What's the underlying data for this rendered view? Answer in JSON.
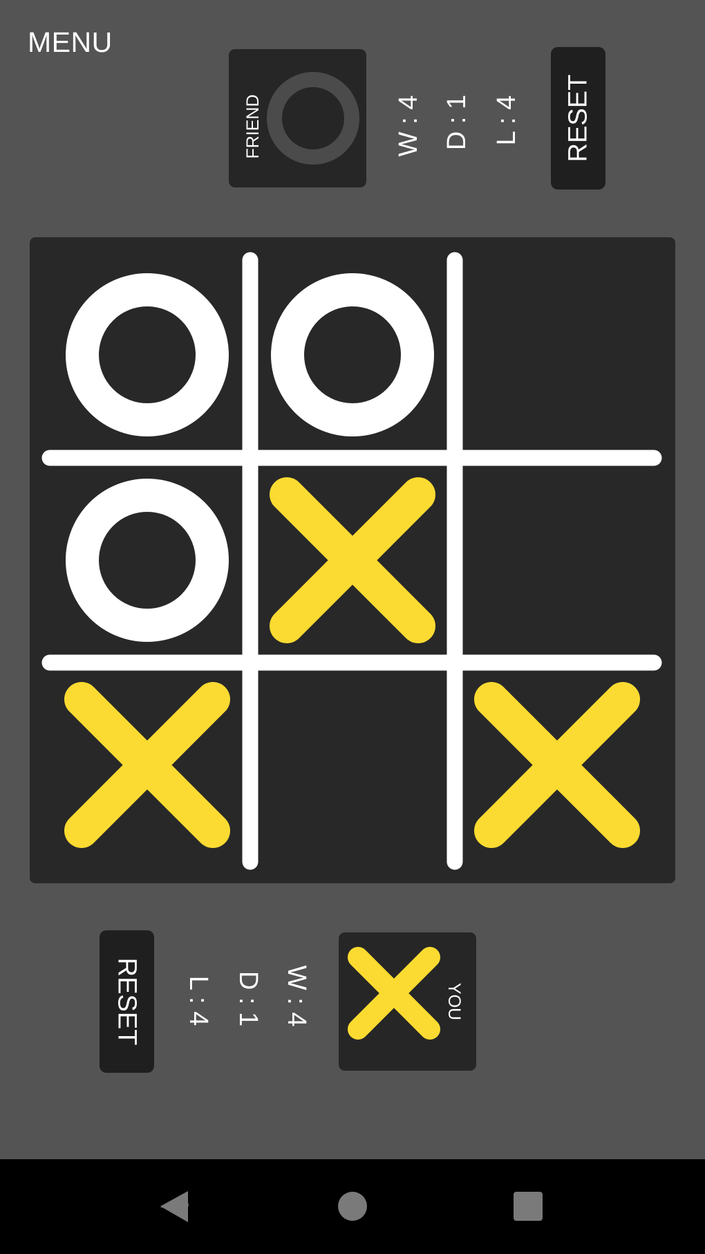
{
  "menu_label": "MENU",
  "colors": {
    "background": "#555455",
    "board": "#282828",
    "x_mark": "#fbdb31",
    "o_mark": "#ffffff",
    "grid": "#ffffff"
  },
  "friend_panel": {
    "label": "FRIEND",
    "symbol": "O",
    "stats": {
      "wins": "W : 4",
      "draws": "D : 1",
      "losses": "L : 4"
    },
    "reset_label": "RESET"
  },
  "you_panel": {
    "label": "YOU",
    "symbol": "X",
    "stats": {
      "wins": "W : 4",
      "draws": "D : 1",
      "losses": "L : 4"
    },
    "reset_label": "RESET"
  },
  "board": {
    "cells": [
      [
        "O",
        "O",
        ""
      ],
      [
        "O",
        "X",
        ""
      ],
      [
        "X",
        "",
        "X"
      ]
    ]
  },
  "navbar": {
    "icons": [
      "back-icon",
      "home-icon",
      "recents-icon"
    ]
  }
}
